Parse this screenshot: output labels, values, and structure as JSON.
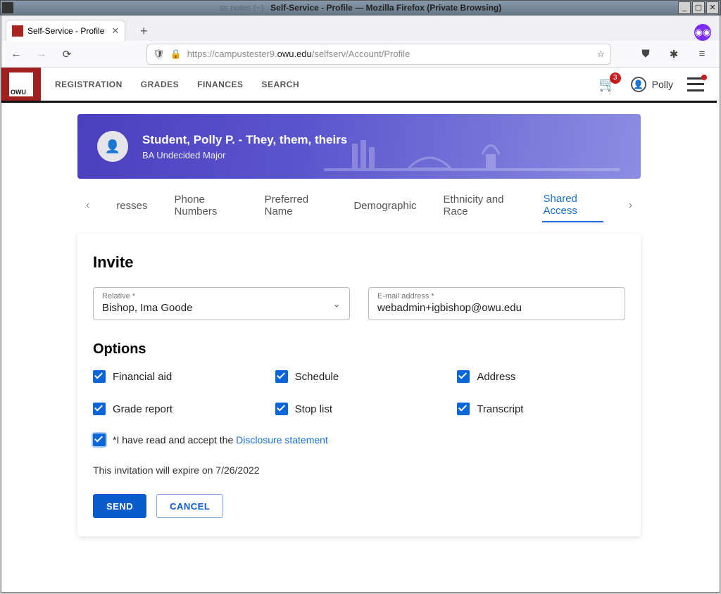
{
  "window": {
    "title_faded": "ss.notes (~)",
    "title": "Self-Service - Profile — Mozilla Firefox (Private Browsing)"
  },
  "browser": {
    "tab_title": "Self-Service - Profile",
    "url_prefix": "https://campustester9.",
    "url_host": "owu.edu",
    "url_path": "/selfserv/Account/Profile"
  },
  "app_header": {
    "nav": {
      "registration": "REGISTRATION",
      "grades": "GRADES",
      "finances": "FINANCES",
      "search": "SEARCH"
    },
    "cart_count": "3",
    "user_name": "Polly"
  },
  "hero": {
    "name_line": "Student, Polly P. - They, them, theirs",
    "major": "BA Undecided Major"
  },
  "subtabs": {
    "t0": "resses",
    "t1": "Phone Numbers",
    "t2": "Preferred Name",
    "t3": "Demographic",
    "t4": "Ethnicity and Race",
    "t5": "Shared Access"
  },
  "invite": {
    "heading": "Invite",
    "relative_label": "Relative *",
    "relative_value": "Bishop, Ima Goode",
    "email_label": "E-mail address *",
    "email_value": "webadmin+igbishop@owu.edu"
  },
  "options": {
    "heading": "Options",
    "items": {
      "financial_aid": "Financial aid",
      "schedule": "Schedule",
      "address": "Address",
      "grade_report": "Grade report",
      "stop_list": "Stop list",
      "transcript": "Transcript"
    },
    "disclosure_prefix": "*I have read and accept the ",
    "disclosure_link": "Disclosure statement",
    "expire_text": "This invitation will expire on 7/26/2022"
  },
  "buttons": {
    "send": "SEND",
    "cancel": "CANCEL"
  }
}
